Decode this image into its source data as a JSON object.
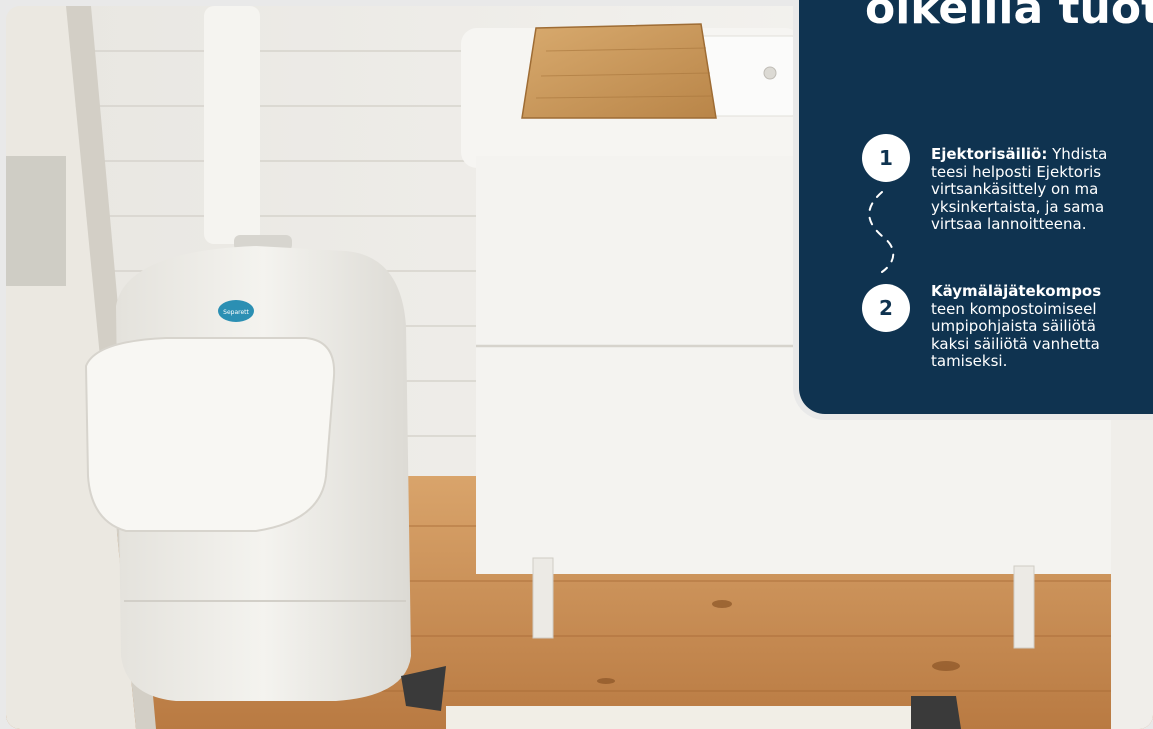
{
  "card": {
    "title_lines": [
      "oikeilla tuot"
    ],
    "items": [
      {
        "number": "1",
        "label": "Ejektorisäiliö:",
        "lines": [
          "Yhdista",
          "teesi helposti Ejektoris",
          "virtsankäsittely on ma",
          "yksinkertaista, ja sama",
          "virtsaa lannoitteena."
        ]
      },
      {
        "number": "2",
        "label": "Käymäläjätekompos",
        "lines": [
          "",
          "teen kompostoimiseel",
          "umpipohjaista säiliötä",
          "kaksi säiliötä vanhetta",
          "tamiseksi."
        ]
      }
    ]
  },
  "photo": {
    "logo_text": "Separett"
  },
  "colors": {
    "card_bg": "#0f3350",
    "card_text": "#ffffff",
    "floor": "#c98f55",
    "wall": "#f2f0ec"
  }
}
